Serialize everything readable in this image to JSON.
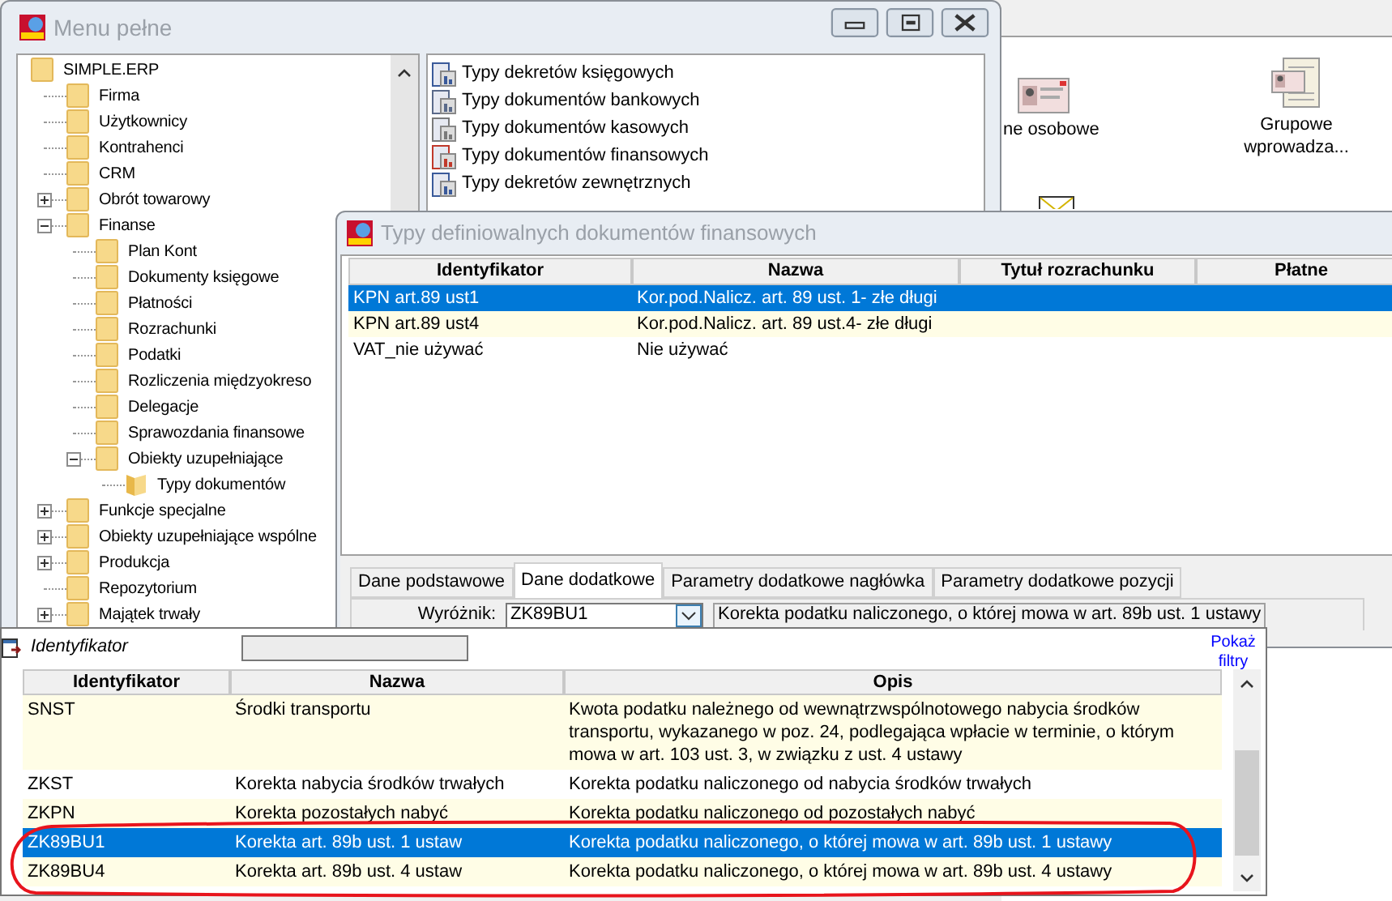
{
  "background_app": {
    "shortcuts": [
      {
        "label": "ne osobowe"
      },
      {
        "label": "Grupowe wprowadza..."
      }
    ]
  },
  "menu_window": {
    "title": "Menu pełne",
    "tree": [
      {
        "label": "SIMPLE.ERP",
        "selected": false,
        "children": [
          {
            "label": "Firma",
            "selected": false
          },
          {
            "label": "Użytkownicy",
            "selected": false
          },
          {
            "label": "Kontrahenci",
            "selected": false
          },
          {
            "label": "CRM",
            "selected": false
          },
          {
            "label": "Obrót towarowy",
            "selected": false,
            "expanded": false
          },
          {
            "label": "Finanse",
            "selected": false,
            "expanded": true,
            "children": [
              {
                "label": "Plan Kont",
                "selected": false
              },
              {
                "label": "Dokumenty księgowe",
                "selected": false
              },
              {
                "label": "Płatności",
                "selected": false
              },
              {
                "label": "Rozrachunki",
                "selected": false
              },
              {
                "label": "Podatki",
                "selected": false
              },
              {
                "label": "Rozliczenia międzyokreso",
                "selected": false
              },
              {
                "label": "Delegacje",
                "selected": false
              },
              {
                "label": "Sprawozdania finansowe",
                "selected": false
              },
              {
                "label": "Obiekty uzupełniające",
                "selected": false,
                "expanded": true,
                "children": [
                  {
                    "label": "Typy dokumentów",
                    "selected": true
                  }
                ]
              }
            ]
          },
          {
            "label": "Funkcje specjalne",
            "selected": false,
            "expanded": false
          },
          {
            "label": "Obiekty uzupełniające wspólne",
            "selected": false,
            "expanded": false
          },
          {
            "label": "Produkcja",
            "selected": false,
            "expanded": false
          },
          {
            "label": "Repozytorium",
            "selected": false
          },
          {
            "label": "Majątek trwały",
            "selected": false,
            "expanded": false
          }
        ]
      }
    ],
    "items": [
      {
        "label": "Typy dekretów księgowych"
      },
      {
        "label": "Typy dokumentów bankowych"
      },
      {
        "label": "Typy dokumentów kasowych"
      },
      {
        "label": "Typy dokumentów finansowych"
      },
      {
        "label": "Typy dekretów zewnętrznych"
      }
    ]
  },
  "doc_types_window": {
    "title": "Typy definiowalnych dokumentów finansowych",
    "columns": [
      "Identyfikator",
      "Nazwa",
      "Tytuł rozrachunku",
      "Płatne"
    ],
    "rows": [
      {
        "id": "KPN art.89 ust1",
        "name": "Kor.pod.Nalicz. art. 89 ust. 1- złe długi",
        "selected": true
      },
      {
        "id": "KPN art.89 ust4",
        "name": "Kor.pod.Nalicz. art. 89 ust.4- złe długi",
        "selected": false
      },
      {
        "id": "VAT_nie używać",
        "name": "Nie używać",
        "selected": false
      }
    ],
    "tabs": [
      {
        "label": "Dane podstawowe",
        "selected": false
      },
      {
        "label": "Dane dodatkowe",
        "selected": true
      },
      {
        "label": "Parametry dodatkowe nagłówka",
        "selected": false
      },
      {
        "label": "Parametry dodatkowe pozycji",
        "selected": false
      }
    ],
    "field": {
      "label": "Wyróżnik:",
      "value": "ZK89BU1",
      "description": "Korekta podatku naliczonego, o której mowa w art. 89b ust. 1 ustawy"
    }
  },
  "lookup_popup": {
    "filter_label": "Identyfikator",
    "link": "Pokaż filtry",
    "columns": [
      "Identyfikator",
      "Nazwa",
      "Opis"
    ],
    "rows": [
      {
        "id": "SNST",
        "name": "Środki transportu",
        "description": "Kwota podatku należnego od wewnątrzwspólnotowego nabycia środków transportu, wykazanego w poz. 24, podlegająca wpłacie w terminie, o którym mowa w art. 103 ust. 3, w związku z ust. 4 ustawy",
        "selected": false
      },
      {
        "id": "ZKST",
        "name": "Korekta nabycia środków trwałych",
        "description": "Korekta podatku naliczonego od nabycia środków trwałych",
        "selected": false
      },
      {
        "id": "ZKPN",
        "name": "Korekta pozostałych nabyć",
        "description": "Korekta podatku naliczonego od pozostałych nabyć",
        "selected": false
      },
      {
        "id": "ZK89BU1",
        "name": "Korekta art. 89b ust. 1 ustaw",
        "description": "Korekta podatku naliczonego, o której mowa w art. 89b ust. 1 ustawy",
        "selected": true
      },
      {
        "id": "ZK89BU4",
        "name": "Korekta art. 89b ust. 4 ustaw",
        "description": "Korekta podatku naliczonego, o której mowa w art. 89b ust. 4 ustawy",
        "selected": false
      }
    ]
  }
}
